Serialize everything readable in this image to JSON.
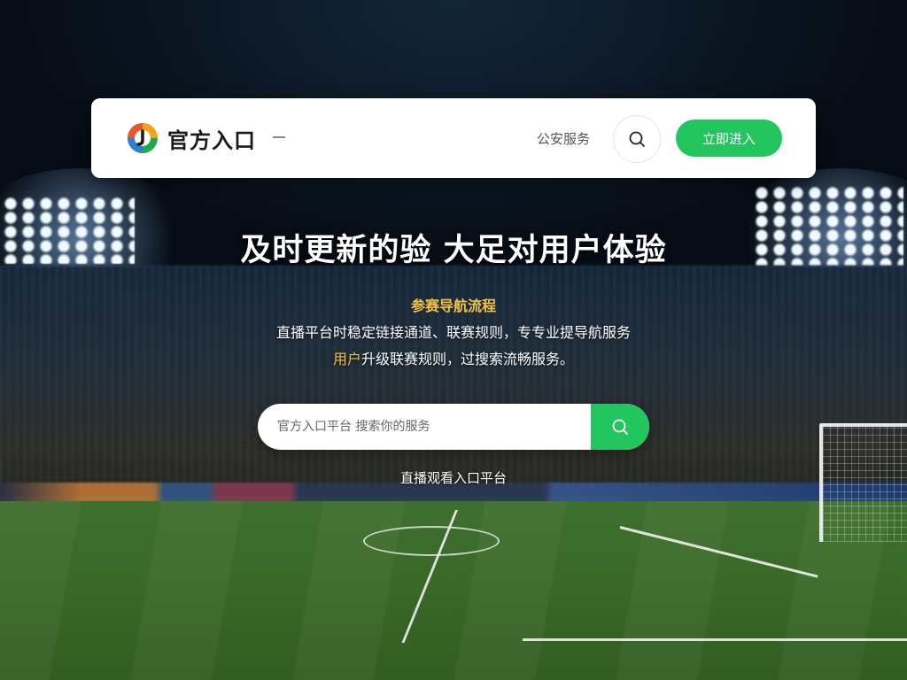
{
  "header": {
    "brand": "官方入口",
    "nav_link": "公安服务",
    "search_icon": "search-icon",
    "cta_label": "立即进入"
  },
  "hero": {
    "title": "及时更新的验 大足对用户体验",
    "subtitle": "参赛导航流程",
    "desc_line1": "直播平台时稳定链接通道、联赛规则，专专业提导航服务",
    "desc_line2_highlight": "用户",
    "desc_line2_rest": "升级联赛规则，过搜索流畅服务。"
  },
  "search": {
    "placeholder": "官方入口平台 搜索你的服务",
    "submit_icon": "search-icon"
  },
  "footer_note": "直播观看入口平台",
  "colors": {
    "accent": "#22c55e",
    "highlight": "#f2c244",
    "card": "#ffffff"
  }
}
